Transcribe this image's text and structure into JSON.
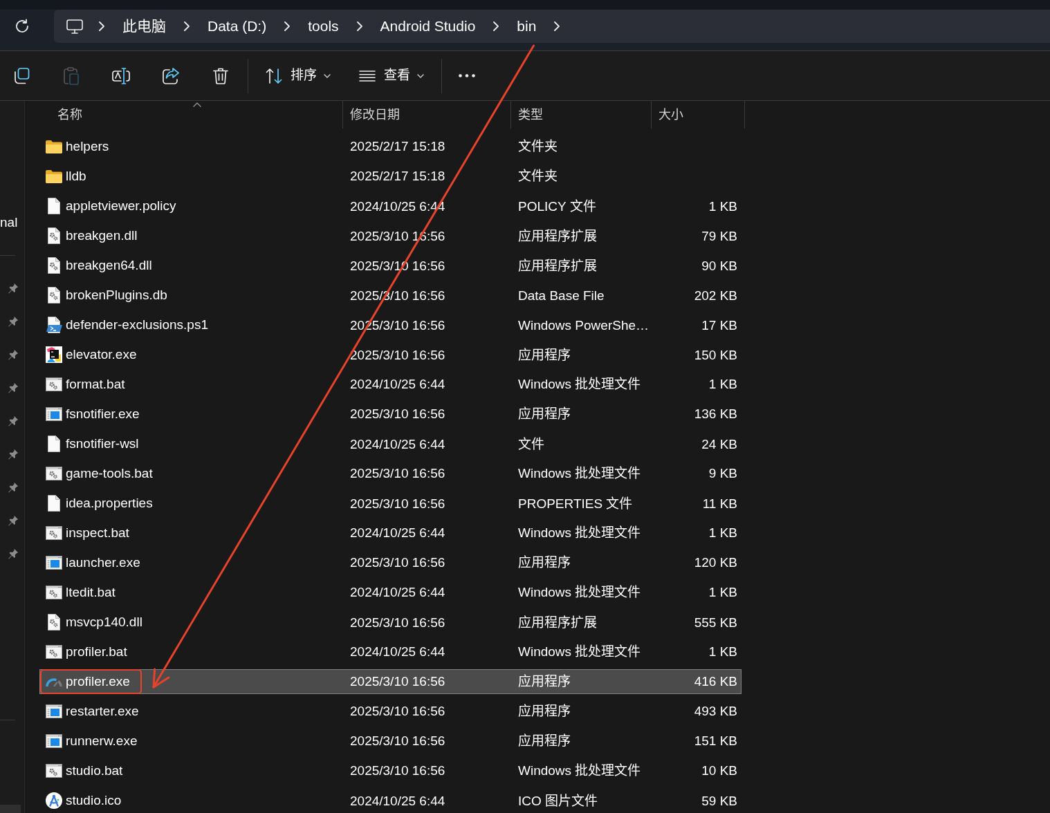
{
  "address_bar": {
    "crumbs": [
      {
        "label": "此电脑"
      },
      {
        "label": "Data (D:)"
      },
      {
        "label": "tools"
      },
      {
        "label": "Android Studio"
      },
      {
        "label": "bin"
      }
    ]
  },
  "toolbar": {
    "actions": [
      {
        "kind": "copy",
        "disabled": false
      },
      {
        "kind": "paste",
        "disabled": true
      },
      {
        "kind": "rename",
        "disabled": false
      },
      {
        "kind": "share",
        "disabled": false
      },
      {
        "kind": "delete",
        "disabled": false
      }
    ],
    "menus": [
      {
        "kind": "sort",
        "label": "排序"
      },
      {
        "kind": "view",
        "label": "查看"
      }
    ]
  },
  "navigation_pane": {
    "sections": [
      {
        "items": [
          {
            "label": "nal",
            "selected": false
          }
        ]
      },
      {
        "items": [
          {
            "pinned": true,
            "selected": false
          },
          {
            "pinned": true,
            "selected": false
          },
          {
            "pinned": true,
            "selected": false
          },
          {
            "pinned": true,
            "selected": false
          },
          {
            "pinned": true,
            "selected": false
          },
          {
            "pinned": true,
            "selected": false
          },
          {
            "pinned": true,
            "selected": false
          },
          {
            "pinned": true,
            "selected": false
          },
          {
            "pinned": true,
            "selected": false
          }
        ]
      },
      {
        "items": [
          {
            "selected": true
          }
        ]
      }
    ]
  },
  "file_list": {
    "columns": [
      {
        "label": "名称",
        "sorted": true
      },
      {
        "label": "修改日期",
        "sorted": false
      },
      {
        "label": "类型",
        "sorted": false
      },
      {
        "label": "大小",
        "sorted": false
      }
    ],
    "rows": [
      {
        "kind": "folder",
        "name": "helpers",
        "modified": "2025/2/17 15:18",
        "type": "文件夹",
        "selected": false,
        "annotated": false
      },
      {
        "kind": "folder",
        "name": "lldb",
        "modified": "2025/2/17 15:18",
        "type": "文件夹",
        "selected": false,
        "annotated": false
      },
      {
        "kind": "document",
        "name": "appletviewer.policy",
        "modified": "2024/10/25 6:44",
        "type": "POLICY 文件",
        "size": "1 KB",
        "selected": false,
        "annotated": false
      },
      {
        "kind": "extension",
        "name": "breakgen.dll",
        "modified": "2025/3/10 16:56",
        "type": "应用程序扩展",
        "size": "79 KB",
        "selected": false,
        "annotated": false
      },
      {
        "kind": "extension",
        "name": "breakgen64.dll",
        "modified": "2025/3/10 16:56",
        "type": "应用程序扩展",
        "size": "90 KB",
        "selected": false,
        "annotated": false
      },
      {
        "kind": "extension",
        "name": "brokenPlugins.db",
        "modified": "2025/3/10 16:56",
        "type": "Data Base File",
        "size": "202 KB",
        "selected": false,
        "annotated": false
      },
      {
        "kind": "powershell",
        "name": "defender-exclusions.ps1",
        "modified": "2025/3/10 16:56",
        "type": "Windows PowerShe…",
        "size": "17 KB",
        "selected": false,
        "annotated": false
      },
      {
        "kind": "logo",
        "name": "elevator.exe",
        "modified": "2025/3/10 16:56",
        "type": "应用程序",
        "size": "150 KB",
        "selected": false,
        "annotated": false
      },
      {
        "kind": "batch",
        "name": "format.bat",
        "modified": "2024/10/25 6:44",
        "type": "Windows 批处理文件",
        "size": "1 KB",
        "selected": false,
        "annotated": false
      },
      {
        "kind": "program",
        "name": "fsnotifier.exe",
        "modified": "2025/3/10 16:56",
        "type": "应用程序",
        "size": "136 KB",
        "selected": false,
        "annotated": false
      },
      {
        "kind": "document",
        "name": "fsnotifier-wsl",
        "modified": "2024/10/25 6:44",
        "type": "文件",
        "size": "24 KB",
        "selected": false,
        "annotated": false
      },
      {
        "kind": "batch",
        "name": "game-tools.bat",
        "modified": "2025/3/10 16:56",
        "type": "Windows 批处理文件",
        "size": "9 KB",
        "selected": false,
        "annotated": false
      },
      {
        "kind": "document",
        "name": "idea.properties",
        "modified": "2025/3/10 16:56",
        "type": "PROPERTIES 文件",
        "size": "11 KB",
        "selected": false,
        "annotated": false
      },
      {
        "kind": "batch",
        "name": "inspect.bat",
        "modified": "2024/10/25 6:44",
        "type": "Windows 批处理文件",
        "size": "1 KB",
        "selected": false,
        "annotated": false
      },
      {
        "kind": "program",
        "name": "launcher.exe",
        "modified": "2025/3/10 16:56",
        "type": "应用程序",
        "size": "120 KB",
        "selected": false,
        "annotated": false
      },
      {
        "kind": "batch",
        "name": "ltedit.bat",
        "modified": "2024/10/25 6:44",
        "type": "Windows 批处理文件",
        "size": "1 KB",
        "selected": false,
        "annotated": false
      },
      {
        "kind": "extension",
        "name": "msvcp140.dll",
        "modified": "2025/3/10 16:56",
        "type": "应用程序扩展",
        "size": "555 KB",
        "selected": false,
        "annotated": false
      },
      {
        "kind": "batch",
        "name": "profiler.bat",
        "modified": "2024/10/25 6:44",
        "type": "Windows 批处理文件",
        "size": "1 KB",
        "selected": false,
        "annotated": false
      },
      {
        "kind": "gauge",
        "name": "profiler.exe",
        "modified": "2025/3/10 16:56",
        "type": "应用程序",
        "size": "416 KB",
        "selected": true,
        "annotated": true
      },
      {
        "kind": "program",
        "name": "restarter.exe",
        "modified": "2025/3/10 16:56",
        "type": "应用程序",
        "size": "493 KB",
        "selected": false,
        "annotated": false
      },
      {
        "kind": "program",
        "name": "runnerw.exe",
        "modified": "2025/3/10 16:56",
        "type": "应用程序",
        "size": "151 KB",
        "selected": false,
        "annotated": false
      },
      {
        "kind": "batch",
        "name": "studio.bat",
        "modified": "2025/3/10 16:56",
        "type": "Windows 批处理文件",
        "size": "10 KB",
        "selected": false,
        "annotated": false
      },
      {
        "kind": "compass",
        "name": "studio.ico",
        "modified": "2024/10/25 6:44",
        "type": "ICO 图片文件",
        "size": "59 KB",
        "selected": false,
        "annotated": false
      }
    ]
  }
}
